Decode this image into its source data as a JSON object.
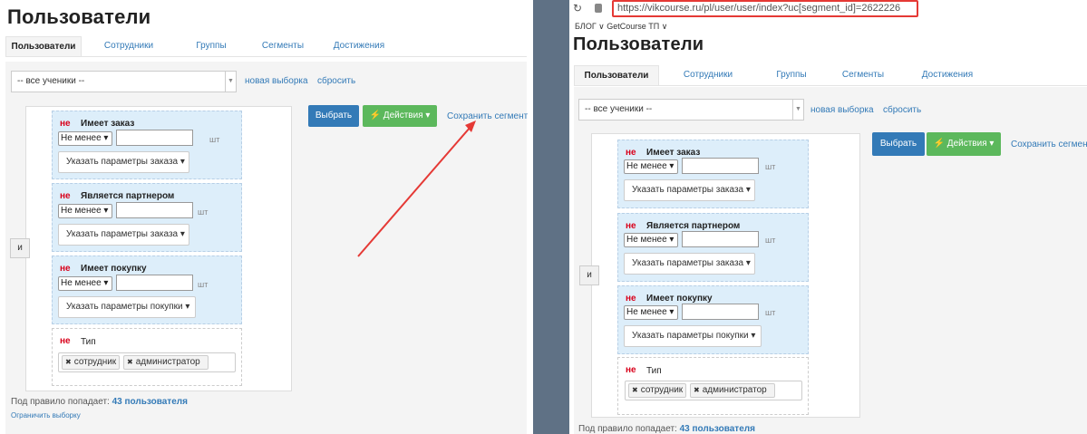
{
  "page_title": "Пользователи",
  "tabs": [
    "Пользователи",
    "Сотрудники",
    "Группы",
    "Сегменты",
    "Достижения"
  ],
  "filter": {
    "select_value": "-- все ученики --",
    "new_selection": "новая выборка",
    "reset": "сбросить"
  },
  "buttons": {
    "select": "Выбрать",
    "actions": "⚡ Действия ▾",
    "save_segment": "Сохранить сегмент",
    "save_segment_short": "Сохранить сегмент"
  },
  "and_label": "и",
  "not_label": "не",
  "unit": "шт",
  "mini_select": "Не менее ▾",
  "rules": [
    {
      "title": "Имеет заказ",
      "params": "Указать параметры заказа ▾"
    },
    {
      "title": "Является партнером",
      "params": "Указать параметры заказа ▾"
    },
    {
      "title": "Имеет покупку",
      "params": "Указать параметры покупки ▾"
    }
  ],
  "type_rule": {
    "title": "Тип",
    "tags": [
      "сотрудник",
      "администратор"
    ]
  },
  "footer": {
    "prefix": "Под правило попадает:",
    "count": "43 пользователя",
    "limit": "Ограничить выборку"
  },
  "browser": {
    "url": "https://vikcourse.ru/pl/user/user/index?uc[segment_id]=2622226",
    "bookmarks": "БЛОГ ∨     GetCourse ТП ∨"
  },
  "colors": {
    "link": "#337ab7",
    "primary": "#337ab7",
    "success": "#5cb85c",
    "not": "#d9001b",
    "arrow": "#e53935",
    "divider": "#5f7185"
  }
}
